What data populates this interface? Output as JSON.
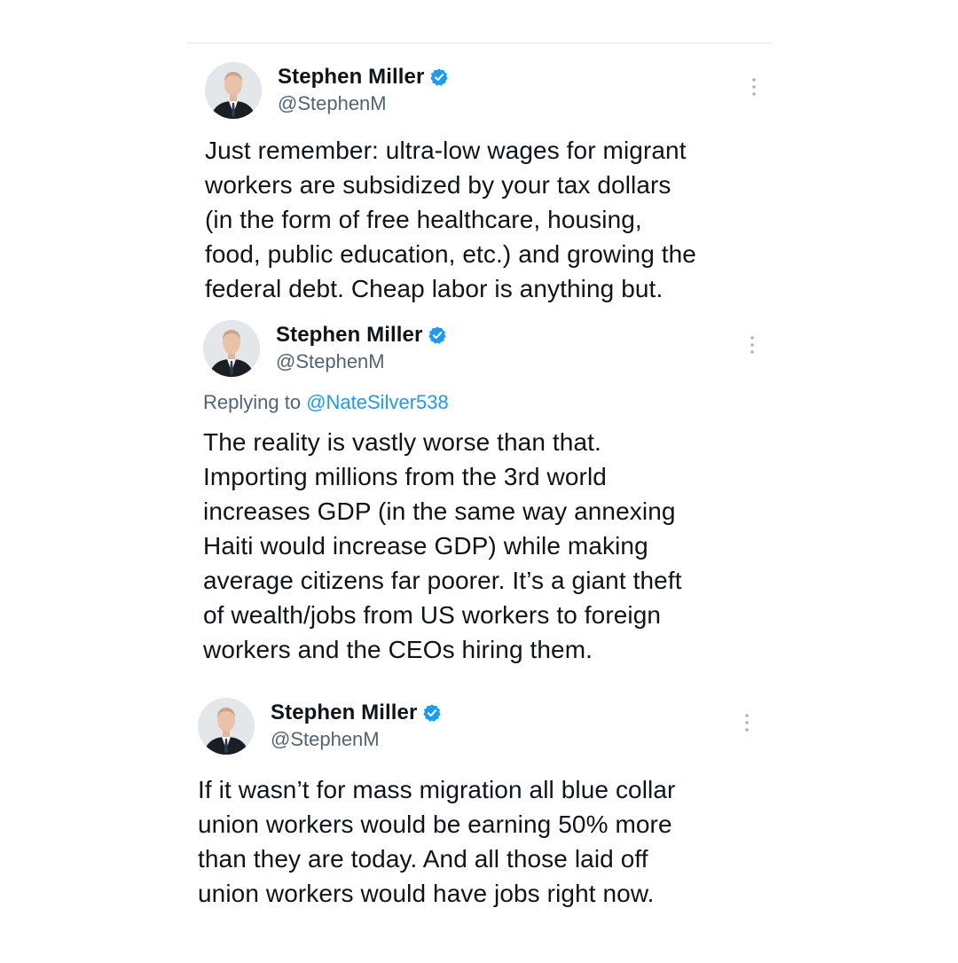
{
  "tweets": [
    {
      "display_name": "Stephen Miller",
      "handle": "@StephenM",
      "verified": true,
      "text": "Just remember: ultra-low wages for migrant\nworkers are subsidized by your tax dollars\n(in the form of free healthcare, housing,\nfood, public education, etc.) and growing the\nfederal debt. Cheap labor is anything but."
    },
    {
      "display_name": "Stephen Miller",
      "handle": "@StephenM",
      "verified": true,
      "replying_prefix": "Replying to",
      "replying_mention": "@NateSilver538",
      "text": "The reality is vastly worse than that.\nImporting millions from the 3rd world\nincreases GDP (in the same way annexing\nHaiti would increase GDP) while making\naverage citizens far poorer. It’s a giant theft\nof wealth/jobs from US workers to foreign\nworkers and the CEOs hiring them."
    },
    {
      "display_name": "Stephen Miller",
      "handle": "@StephenM",
      "verified": true,
      "text": "If it wasn’t for mass migration all blue collar\nunion workers would be earning 50% more\nthan they are today. And all those laid off\nunion workers would have jobs right now."
    }
  ],
  "colors": {
    "verified_badge": "#1d9bf0",
    "mention": "#1d9bf0",
    "secondary_text": "#536471",
    "primary_text": "#0f1419"
  },
  "icons": {
    "verified": "verified-badge-icon",
    "more": "more-vertical-icon",
    "avatar": "avatar"
  }
}
